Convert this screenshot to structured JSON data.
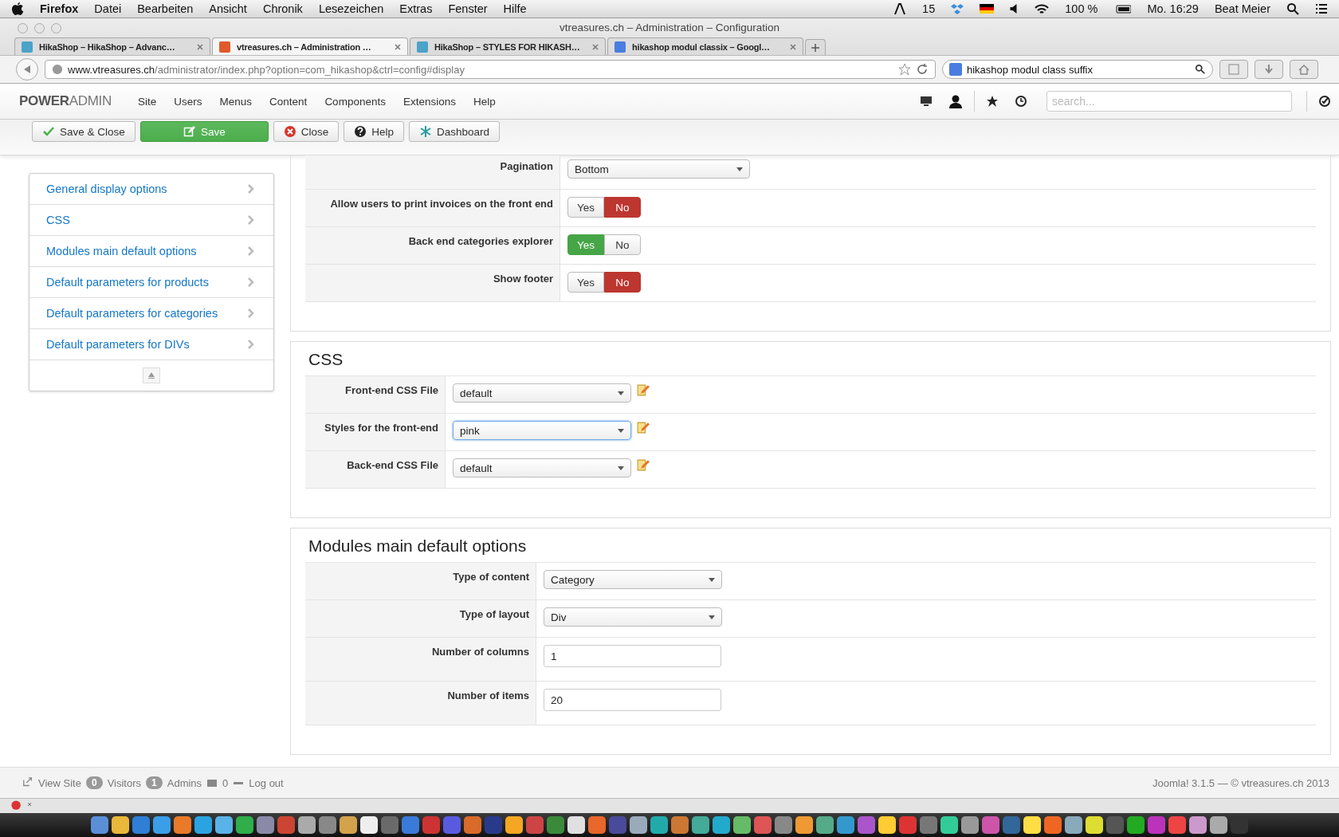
{
  "menubar": {
    "app": "Firefox",
    "menus": [
      "Datei",
      "Bearbeiten",
      "Ansicht",
      "Chronik",
      "Lesezeichen",
      "Extras",
      "Fenster",
      "Hilfe"
    ],
    "badge_count": "15",
    "battery": "100 %",
    "clock": "Mo. 16:29",
    "user": "Beat Meier"
  },
  "window": {
    "title": "vtreasures.ch – Administration – Configuration"
  },
  "tabs": [
    {
      "label": "HikaShop – HikaShop – Advanc…",
      "selected": false
    },
    {
      "label": "vtreasures.ch – Administration …",
      "selected": true
    },
    {
      "label": "HikaShop – STYLES FOR HIKASH…",
      "selected": false
    },
    {
      "label": "hikashop modul classix – Googl…",
      "selected": false
    }
  ],
  "address": {
    "host": "www.vtreasures.ch",
    "path": "/administrator/index.php?option=com_hikashop&ctrl=config#display"
  },
  "web_search": {
    "value": "hikashop modul class suffix"
  },
  "admin": {
    "brand_strong": "POWER",
    "brand_light": "ADMIN",
    "nav": [
      "Site",
      "Users",
      "Menus",
      "Content",
      "Components",
      "Extensions",
      "Help"
    ],
    "search_placeholder": "search..."
  },
  "toolbar": [
    {
      "kind": "check",
      "label": "Save & Close"
    },
    {
      "kind": "save",
      "label": "Save"
    },
    {
      "kind": "close",
      "label": "Close"
    },
    {
      "kind": "help",
      "label": "Help"
    },
    {
      "kind": "dashboard",
      "label": "Dashboard"
    }
  ],
  "sidebar": {
    "items": [
      "General display options",
      "CSS",
      "Modules main default options",
      "Default parameters for products",
      "Default parameters for categories",
      "Default parameters for DIVs"
    ]
  },
  "sections": [
    {
      "rows": [
        {
          "label": "Pagination",
          "kind": "select",
          "value": "Bottom"
        },
        {
          "label": "Allow users to print invoices on the front end",
          "kind": "toggle",
          "yes": "Yes",
          "no": "No",
          "on": false
        },
        {
          "label": "Back end categories explorer",
          "kind": "toggle",
          "yes": "Yes",
          "no": "No",
          "on": true
        },
        {
          "label": "Show footer",
          "kind": "toggle",
          "yes": "Yes",
          "no": "No",
          "on": false
        }
      ]
    },
    {
      "legend": "CSS",
      "rows": [
        {
          "label": "Front-end CSS File",
          "kind": "select",
          "value": "default",
          "editable": true
        },
        {
          "label": "Styles for the front-end",
          "kind": "select",
          "value": "pink",
          "editable": true,
          "focused": true
        },
        {
          "label": "Back-end CSS File",
          "kind": "select",
          "value": "default",
          "editable": true
        }
      ]
    },
    {
      "legend": "Modules main default options",
      "rows": [
        {
          "label": "Type of content",
          "kind": "select",
          "value": "Category"
        },
        {
          "label": "Type of layout",
          "kind": "select",
          "value": "Div"
        },
        {
          "label": "Number of columns",
          "kind": "text",
          "value": "1"
        },
        {
          "label": "Number of items",
          "kind": "text",
          "value": "20"
        }
      ]
    }
  ],
  "footer": {
    "view_site": "View Site",
    "visitors_count": "0",
    "visitors": "Visitors",
    "admins_count": "1",
    "admins": "Admins",
    "messages": "0",
    "logout": "Log out",
    "version": "Joomla! 3.1.5  —  © vtreasures.ch 2013"
  }
}
